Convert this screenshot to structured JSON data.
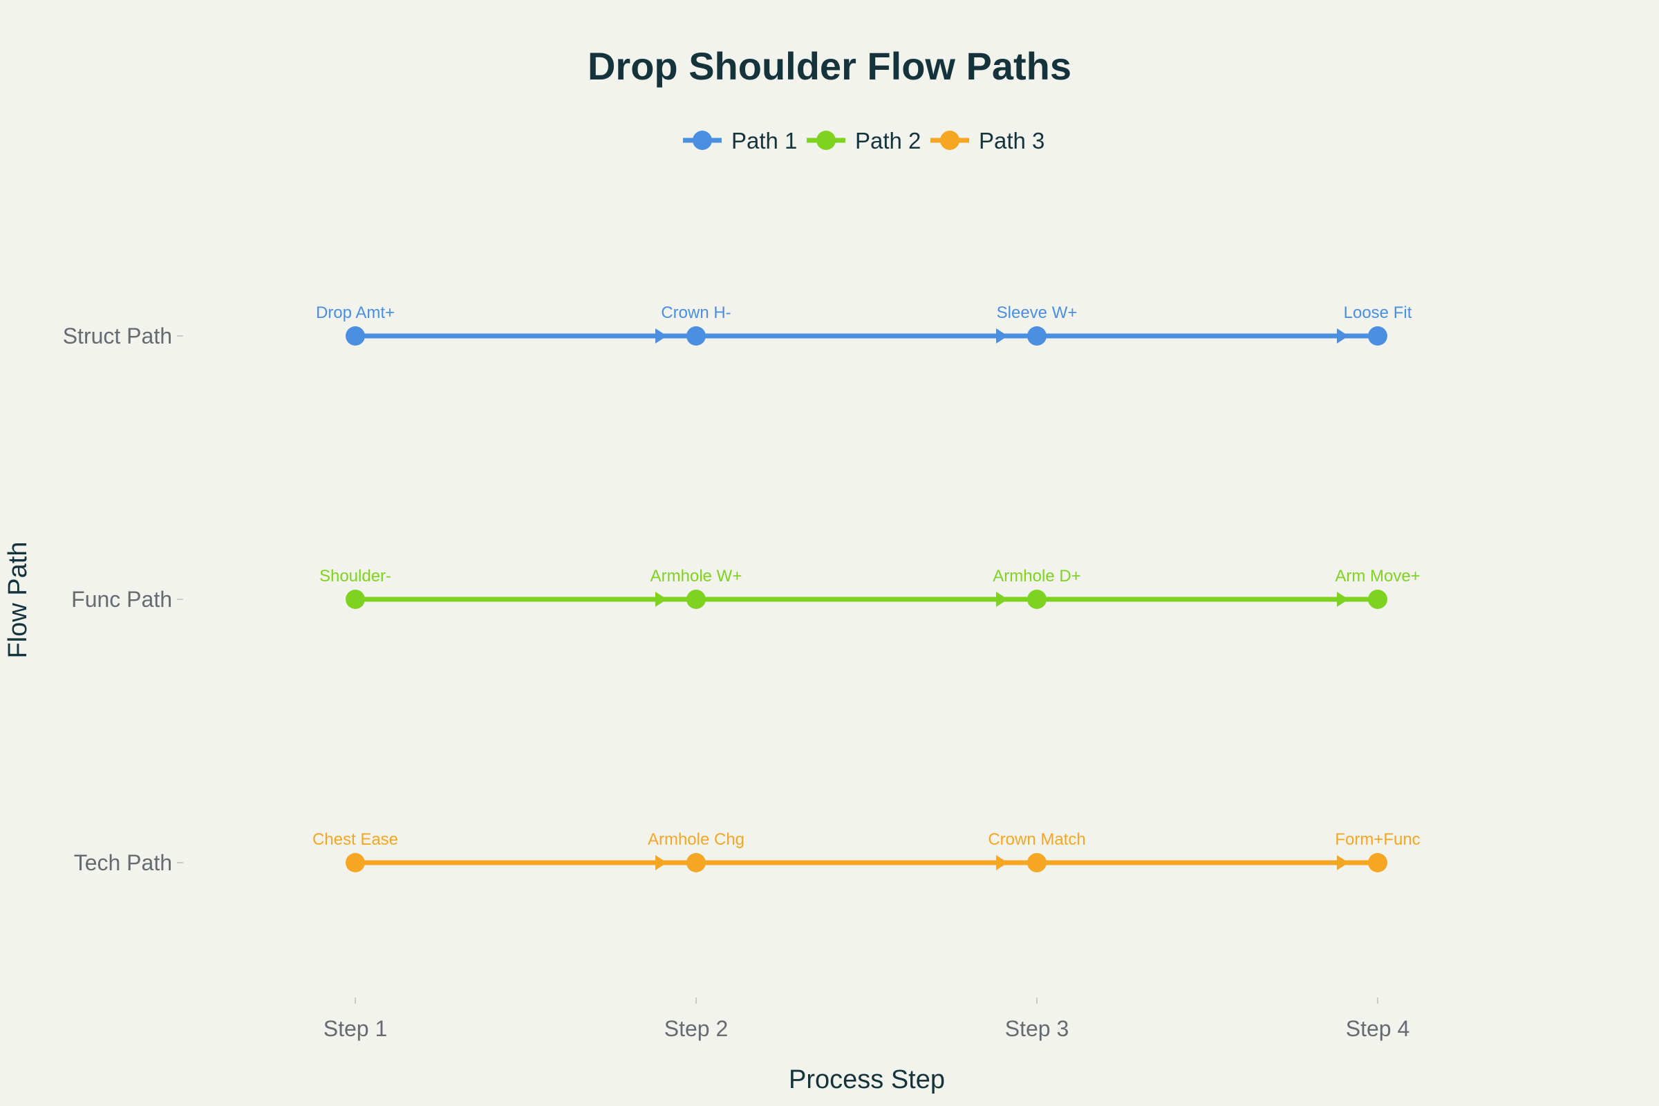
{
  "chart_data": {
    "type": "line",
    "title": "Drop Shoulder Flow Paths",
    "xlabel": "Process Step",
    "ylabel": "Flow Path",
    "categories": [
      "Step 1",
      "Step 2",
      "Step 3",
      "Step 4"
    ],
    "y_categories": [
      "Struct Path",
      "Func Path",
      "Tech Path"
    ],
    "legend_position": "top-center",
    "grid": false,
    "series": [
      {
        "name": "Path 1",
        "row": "Struct Path",
        "color": "#4a8fe0",
        "labels": [
          "Drop Amt+",
          "Crown H-",
          "Sleeve W+",
          "Loose Fit"
        ]
      },
      {
        "name": "Path 2",
        "row": "Func Path",
        "color": "#7ed321",
        "labels": [
          "Shoulder-",
          "Armhole W+",
          "Armhole D+",
          "Arm Move+"
        ]
      },
      {
        "name": "Path 3",
        "row": "Tech Path",
        "color": "#f5a623",
        "labels": [
          "Chest Ease",
          "Armhole Chg",
          "Crown Match",
          "Form+Func"
        ]
      }
    ]
  }
}
